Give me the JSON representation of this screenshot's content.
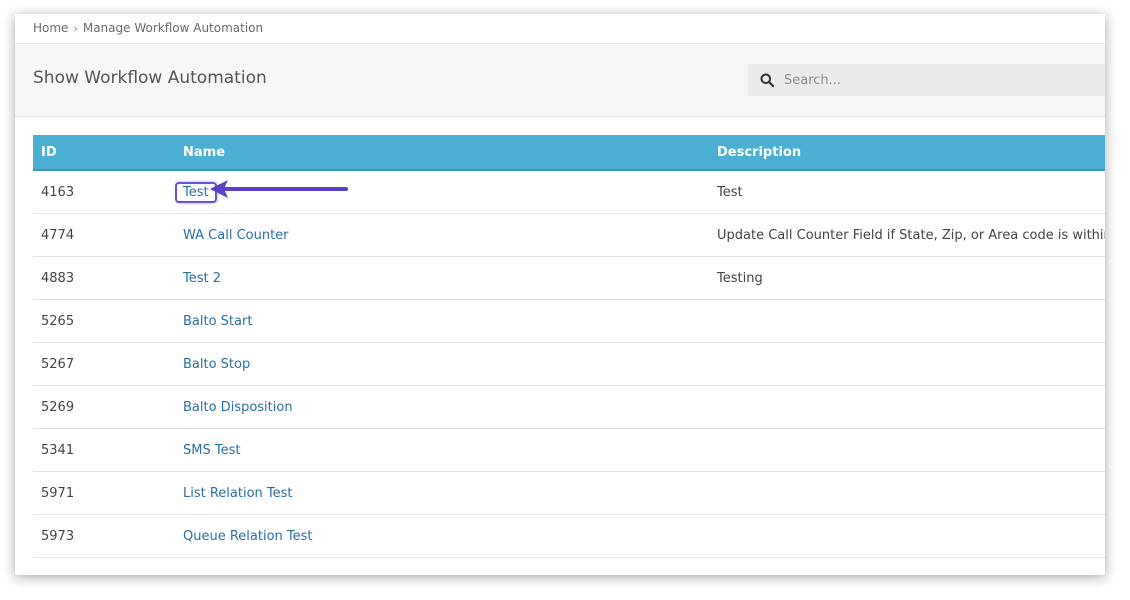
{
  "breadcrumb": {
    "home": "Home",
    "separator": "›",
    "current": "Manage Workflow Automation"
  },
  "page": {
    "title": "Show Workflow Automation"
  },
  "search": {
    "placeholder": "Search...",
    "value": ""
  },
  "table": {
    "headers": [
      "ID",
      "Name",
      "Description"
    ],
    "rows": [
      {
        "id": "4163",
        "name": "Test",
        "description": "Test"
      },
      {
        "id": "4774",
        "name": "WA Call Counter",
        "description": "Update Call Counter Field if State, Zip, or Area code is within WA"
      },
      {
        "id": "4883",
        "name": "Test 2",
        "description": "Testing"
      },
      {
        "id": "5265",
        "name": "Balto Start",
        "description": ""
      },
      {
        "id": "5267",
        "name": "Balto Stop",
        "description": ""
      },
      {
        "id": "5269",
        "name": "Balto Disposition",
        "description": ""
      },
      {
        "id": "5341",
        "name": "SMS Test",
        "description": ""
      },
      {
        "id": "5971",
        "name": "List Relation Test",
        "description": ""
      },
      {
        "id": "5973",
        "name": "Queue Relation Test",
        "description": ""
      }
    ]
  },
  "colors": {
    "header_bg": "#4bafd3",
    "link": "#2a6fa0",
    "annotation": "#6b50d8"
  },
  "icons": {
    "search": "search-icon",
    "annotation": "arrow-left-icon"
  }
}
